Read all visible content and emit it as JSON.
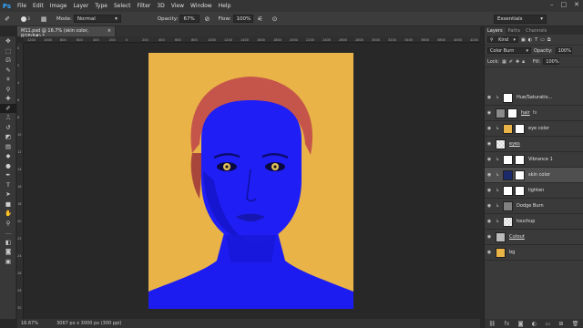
{
  "menubar": {
    "logo": "Ps",
    "items": [
      "File",
      "Edit",
      "Image",
      "Layer",
      "Type",
      "Select",
      "Filter",
      "3D",
      "View",
      "Window",
      "Help"
    ],
    "controls": [
      "–",
      "□",
      "✕"
    ]
  },
  "options": {
    "mode_label": "Mode:",
    "mode_value": "Normal",
    "opacity_label": "Opacity:",
    "opacity_value": "67%",
    "flow_label": "Flow:",
    "flow_value": "100%",
    "brush_size": "3",
    "workspace": "Essentials"
  },
  "document": {
    "tab_title": "M11.psd @ 16.7% (skin color, RGB/8#) *",
    "tab_close": "×",
    "zoom": "16.67%",
    "doc_info": "3067 px x 3000 px (300 ppi)"
  },
  "ruler": {
    "h": [
      "1200",
      "1000",
      "800",
      "600",
      "400",
      "200",
      "0",
      "200",
      "400",
      "600",
      "800",
      "1000",
      "1200",
      "1400",
      "1600",
      "1800",
      "2000",
      "2200",
      "2400",
      "2600",
      "2800",
      "3000",
      "3200",
      "3400",
      "3600",
      "3800",
      "4000",
      "4200"
    ],
    "v": [
      "0",
      "2",
      "4",
      "6",
      "8",
      "10",
      "12",
      "14",
      "16",
      "18",
      "20",
      "22",
      "24",
      "26",
      "28",
      "30"
    ]
  },
  "toolbar": {
    "tools": [
      {
        "name": "move-tool-icon",
        "glyph": "✥"
      },
      {
        "name": "marquee-tool-icon",
        "glyph": "⬚"
      },
      {
        "name": "lasso-tool-icon",
        "glyph": "ᘏ"
      },
      {
        "name": "quick-select-tool-icon",
        "glyph": "✎"
      },
      {
        "name": "crop-tool-icon",
        "glyph": "⌗"
      },
      {
        "name": "eyedropper-tool-icon",
        "glyph": "⚲"
      },
      {
        "name": "healing-tool-icon",
        "glyph": "✚"
      },
      {
        "name": "brush-tool-icon",
        "glyph": "✐"
      },
      {
        "name": "clone-stamp-tool-icon",
        "glyph": "⎍"
      },
      {
        "name": "history-brush-tool-icon",
        "glyph": "↺"
      },
      {
        "name": "eraser-tool-icon",
        "glyph": "◩"
      },
      {
        "name": "gradient-tool-icon",
        "glyph": "▤"
      },
      {
        "name": "blur-tool-icon",
        "glyph": "◆"
      },
      {
        "name": "dodge-tool-icon",
        "glyph": "●"
      },
      {
        "name": "pen-tool-icon",
        "glyph": "✒"
      },
      {
        "name": "type-tool-icon",
        "glyph": "T"
      },
      {
        "name": "path-select-tool-icon",
        "glyph": "➤"
      },
      {
        "name": "shape-tool-icon",
        "glyph": "■"
      },
      {
        "name": "hand-tool-icon",
        "glyph": "✋"
      },
      {
        "name": "zoom-tool-icon",
        "glyph": "⚲"
      },
      {
        "name": "more-tools-icon",
        "glyph": "…"
      },
      {
        "name": "colors-icon",
        "glyph": "◧"
      },
      {
        "name": "quick-mask-icon",
        "glyph": "◙"
      },
      {
        "name": "screen-mode-icon",
        "glyph": "▣"
      }
    ],
    "active_index": 7
  },
  "panel": {
    "tabs": [
      "Layers",
      "Paths",
      "Channels"
    ],
    "kind_label": "Kind",
    "blend_mode": "Color Burn",
    "opacity_label": "Opacity:",
    "opacity_value": "100%",
    "lock_label": "Lock:",
    "fill_label": "Fill:",
    "fill_value": "100%"
  },
  "layers": [
    {
      "name": "Hue/Saturatio...",
      "thumb": "#ffffff",
      "mask": false,
      "clip": true,
      "fx": false,
      "selected": false,
      "underline": false
    },
    {
      "name": "hair",
      "thumb": "#8a8a8a",
      "mask": true,
      "clip": false,
      "fx": true,
      "selected": false,
      "underline": true
    },
    {
      "name": "eye color",
      "thumb": "#e9b348",
      "mask": true,
      "clip": true,
      "fx": false,
      "selected": false,
      "underline": false
    },
    {
      "name": "eyes",
      "thumb": "checker",
      "mask": false,
      "clip": false,
      "fx": false,
      "selected": false,
      "underline": true
    },
    {
      "name": "Vibrance 1",
      "thumb": "#ffffff",
      "mask": true,
      "clip": true,
      "fx": false,
      "selected": false,
      "underline": false
    },
    {
      "name": "skin color",
      "thumb": "#1a2a6a",
      "mask": true,
      "clip": true,
      "fx": false,
      "selected": true,
      "underline": false
    },
    {
      "name": "lighten",
      "thumb": "#ffffff",
      "mask": true,
      "clip": true,
      "fx": false,
      "selected": false,
      "underline": false
    },
    {
      "name": "Dodge Burn",
      "thumb": "#808080",
      "mask": false,
      "clip": true,
      "fx": false,
      "selected": false,
      "underline": false
    },
    {
      "name": "touchup",
      "thumb": "checker",
      "mask": false,
      "clip": true,
      "fx": false,
      "selected": false,
      "underline": false
    },
    {
      "name": "Cutout",
      "thumb": "#bbbbbb",
      "mask": false,
      "clip": false,
      "fx": false,
      "selected": false,
      "underline": true
    },
    {
      "name": "bg",
      "thumb": "#e9b348",
      "mask": false,
      "clip": false,
      "fx": false,
      "selected": false,
      "underline": false
    }
  ],
  "colors": {
    "artwork_bg": "#e9b348",
    "skin": "#1c1cf0",
    "hair": "#c5554a",
    "eyes": "#e6c25a"
  }
}
